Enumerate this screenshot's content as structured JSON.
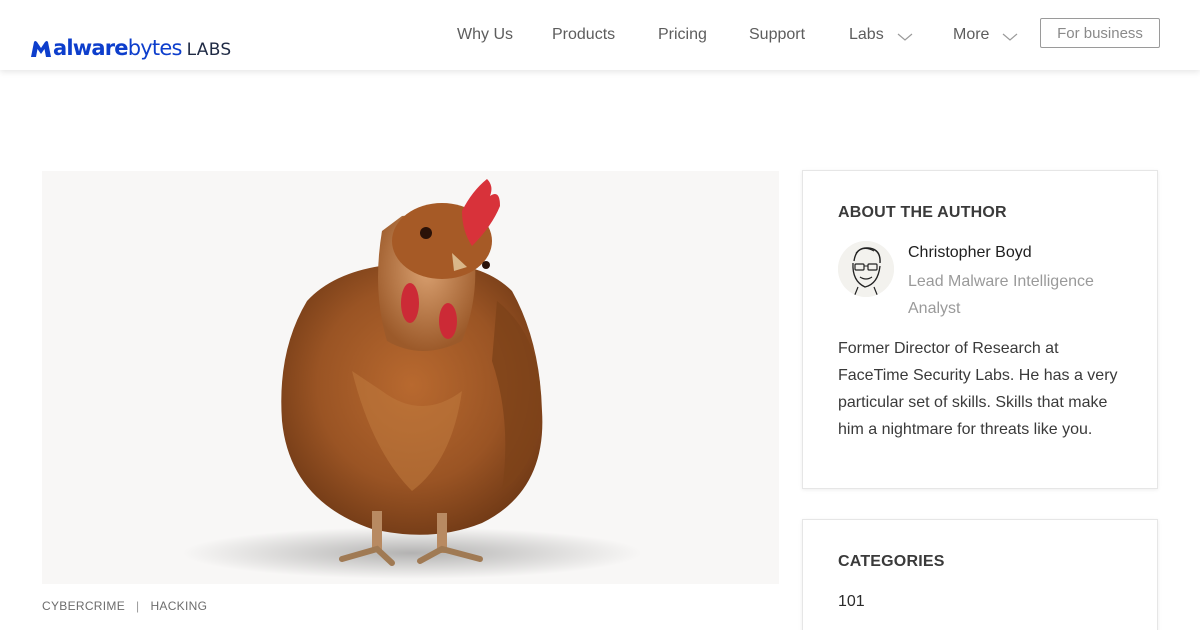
{
  "header": {
    "logo": {
      "brand": "Malwarebytes",
      "suffix": "LABS"
    },
    "nav": [
      {
        "label": "Why Us",
        "dropdown": false
      },
      {
        "label": "Products",
        "dropdown": false
      },
      {
        "label": "Pricing",
        "dropdown": false
      },
      {
        "label": "Support",
        "dropdown": false
      },
      {
        "label": "Labs",
        "dropdown": true
      },
      {
        "label": "More",
        "dropdown": true
      }
    ],
    "business_button": "For business"
  },
  "article": {
    "hero_image": {
      "subject": "chicken"
    },
    "tags": [
      "CYBERCRIME",
      "HACKING"
    ],
    "tag_separator": "|"
  },
  "sidebar": {
    "about": {
      "heading": "ABOUT THE AUTHOR",
      "author_name": "Christopher Boyd",
      "author_role": "Lead Malware Intelligence Analyst",
      "bio": "Former Director of Research at FaceTime Security Labs. He has a very particular set of skills. Skills that make him a nightmare for threats like you."
    },
    "categories": {
      "heading": "CATEGORIES",
      "items": [
        "101"
      ]
    }
  },
  "colors": {
    "brand_blue": "#0d3ecc",
    "nav_text": "#5d5d5d",
    "muted_text": "#9a9a9a",
    "card_border": "#e6e6e6"
  },
  "icons": {
    "logo": "malwarebytes-m-logo",
    "dropdown": "chevron-down-icon"
  }
}
